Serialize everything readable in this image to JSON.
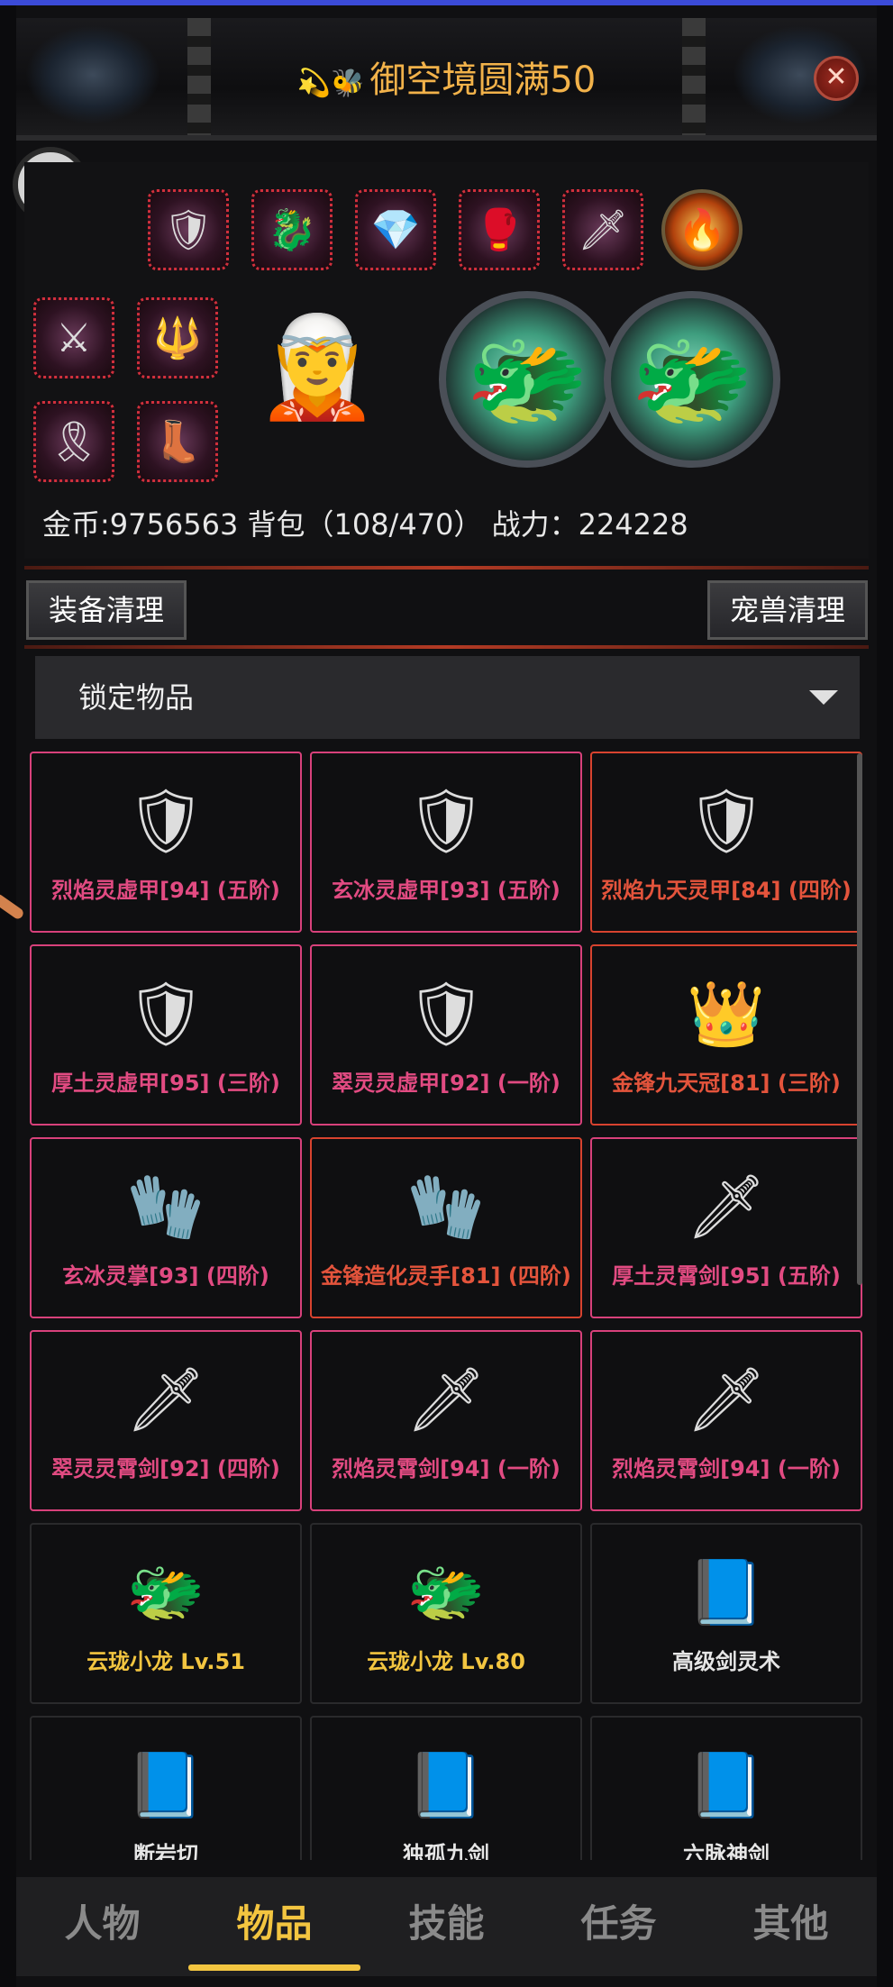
{
  "header": {
    "title": "御空境圆满50",
    "title_emoji": "💫🐝"
  },
  "equipment": {
    "stats_text": "金币:9756563 背包（108/470） 战力：224228"
  },
  "buttons": {
    "equip_cleanup": "装备清理",
    "pet_cleanup": "宠兽清理"
  },
  "filter": {
    "selected": "锁定物品"
  },
  "items": [
    {
      "name": "烈焰灵虚甲[94] (五阶)",
      "color": "#e24b82",
      "icon": "armor-icon"
    },
    {
      "name": "玄冰灵虚甲[93] (五阶)",
      "color": "#e24b82",
      "icon": "armor-icon"
    },
    {
      "name": "烈焰九天灵甲[84] (四阶)",
      "color": "#e4543c",
      "icon": "armor-icon"
    },
    {
      "name": "厚土灵虚甲[95] (三阶)",
      "color": "#e24b82",
      "icon": "armor-icon"
    },
    {
      "name": "翠灵灵虚甲[92] (一阶)",
      "color": "#e24b82",
      "icon": "armor-icon"
    },
    {
      "name": "金锋九天冠[81] (三阶)",
      "color": "#e4543c",
      "icon": "crown-icon"
    },
    {
      "name": "玄冰灵掌[93] (四阶)",
      "color": "#e24b82",
      "icon": "gauntlet-icon"
    },
    {
      "name": "金锋造化灵手[81] (四阶)",
      "color": "#e4543c",
      "icon": "gauntlet-icon"
    },
    {
      "name": "厚土灵霄剑[95] (五阶)",
      "color": "#e24b82",
      "icon": "sword-icon"
    },
    {
      "name": "翠灵灵霄剑[92] (四阶)",
      "color": "#e24b82",
      "icon": "sword-icon"
    },
    {
      "name": "烈焰灵霄剑[94] (一阶)",
      "color": "#e24b82",
      "icon": "sword-icon"
    },
    {
      "name": "烈焰灵霄剑[94] (一阶)",
      "color": "#e24b82",
      "icon": "sword-icon"
    },
    {
      "name": "云珑小龙 Lv.51",
      "color": "#f3c540",
      "icon": "dragon-pet-icon"
    },
    {
      "name": "云珑小龙 Lv.80",
      "color": "#f3c540",
      "icon": "dragon-pet-icon"
    },
    {
      "name": "高级剑灵术",
      "color": "#e6e6e6",
      "icon": "skill-book-icon"
    },
    {
      "name": "断岩切",
      "color": "#e6e6e6",
      "icon": "skill-book-icon"
    },
    {
      "name": "独孤九剑",
      "color": "#e6e6e6",
      "icon": "skill-book-icon"
    },
    {
      "name": "六脉神剑",
      "color": "#e6e6e6",
      "icon": "skill-book-icon"
    }
  ],
  "nav": {
    "tabs": [
      {
        "label": "人物"
      },
      {
        "label": "物品"
      },
      {
        "label": "技能"
      },
      {
        "label": "任务"
      },
      {
        "label": "其他"
      }
    ],
    "active": 1
  },
  "colors": {
    "accent": "#f3c540",
    "title": "#f2b24a",
    "danger": "#d8432f",
    "pink": "#d8417b"
  }
}
